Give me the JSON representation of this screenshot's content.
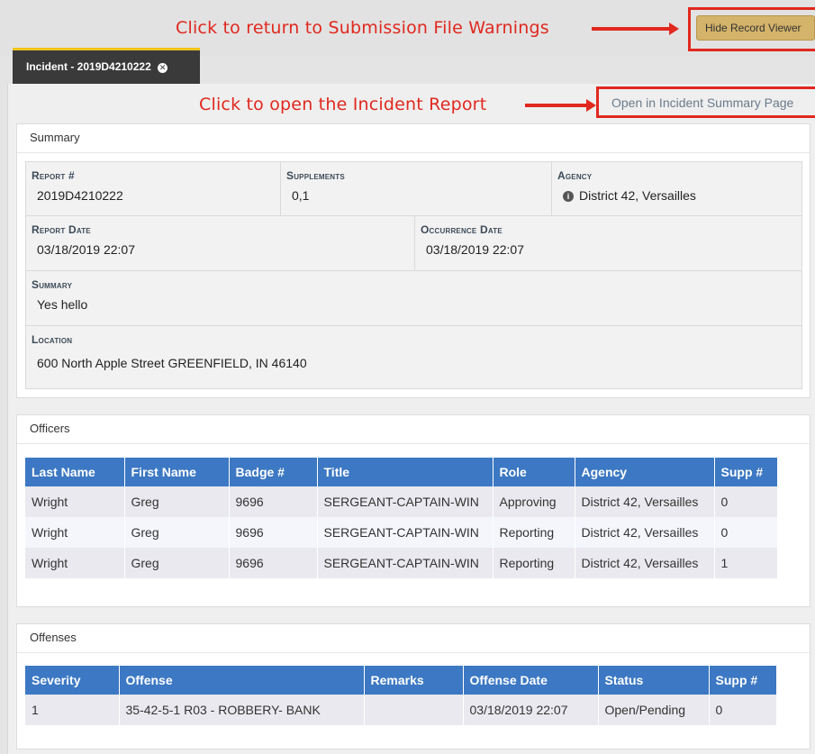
{
  "annotations": {
    "return_hint": "Click to return to Submission File Warnings",
    "open_hint": "Click to open the Incident Report"
  },
  "toolbar": {
    "hide_record_viewer": "Hide Record Viewer"
  },
  "tab": {
    "label": "Incident - 2019D4210222"
  },
  "open_summary_link": "Open in Incident Summary Page",
  "summary": {
    "heading": "Summary",
    "report_label": "Report #",
    "report_value": "2019D4210222",
    "supplements_label": "Supplements",
    "supplements_value": "0,1",
    "agency_label": "Agency",
    "agency_value": "District 42, Versailles",
    "report_date_label": "Report Date",
    "report_date_value": "03/18/2019 22:07",
    "occurrence_date_label": "Occurrence Date",
    "occurrence_date_value": "03/18/2019 22:07",
    "summary_label": "Summary",
    "summary_value": "Yes hello",
    "location_label": "Location",
    "location_value": "600 North Apple Street GREENFIELD, IN 46140"
  },
  "officers": {
    "heading": "Officers",
    "columns": [
      "Last Name",
      "First Name",
      "Badge #",
      "Title",
      "Role",
      "Agency",
      "Supp #"
    ],
    "rows": [
      [
        "Wright",
        "Greg",
        "9696",
        "SERGEANT-CAPTAIN-WIN",
        "Approving",
        "District 42, Versailles",
        "0"
      ],
      [
        "Wright",
        "Greg",
        "9696",
        "SERGEANT-CAPTAIN-WIN",
        "Reporting",
        "District 42, Versailles",
        "0"
      ],
      [
        "Wright",
        "Greg",
        "9696",
        "SERGEANT-CAPTAIN-WIN",
        "Reporting",
        "District 42, Versailles",
        "1"
      ]
    ]
  },
  "offenses": {
    "heading": "Offenses",
    "columns": [
      "Severity",
      "Offense",
      "Remarks",
      "Offense Date",
      "Status",
      "Supp #"
    ],
    "rows": [
      [
        "1",
        "35-42-5-1 R03 - ROBBERY- BANK",
        "",
        "03/18/2019 22:07",
        "Open/Pending",
        "0"
      ]
    ]
  },
  "colors": {
    "annotation_red": "#e0281e",
    "table_header_blue": "#3c78c3",
    "tab_accent_yellow": "#f0c419",
    "hide_button_gold": "#d4b36a"
  }
}
